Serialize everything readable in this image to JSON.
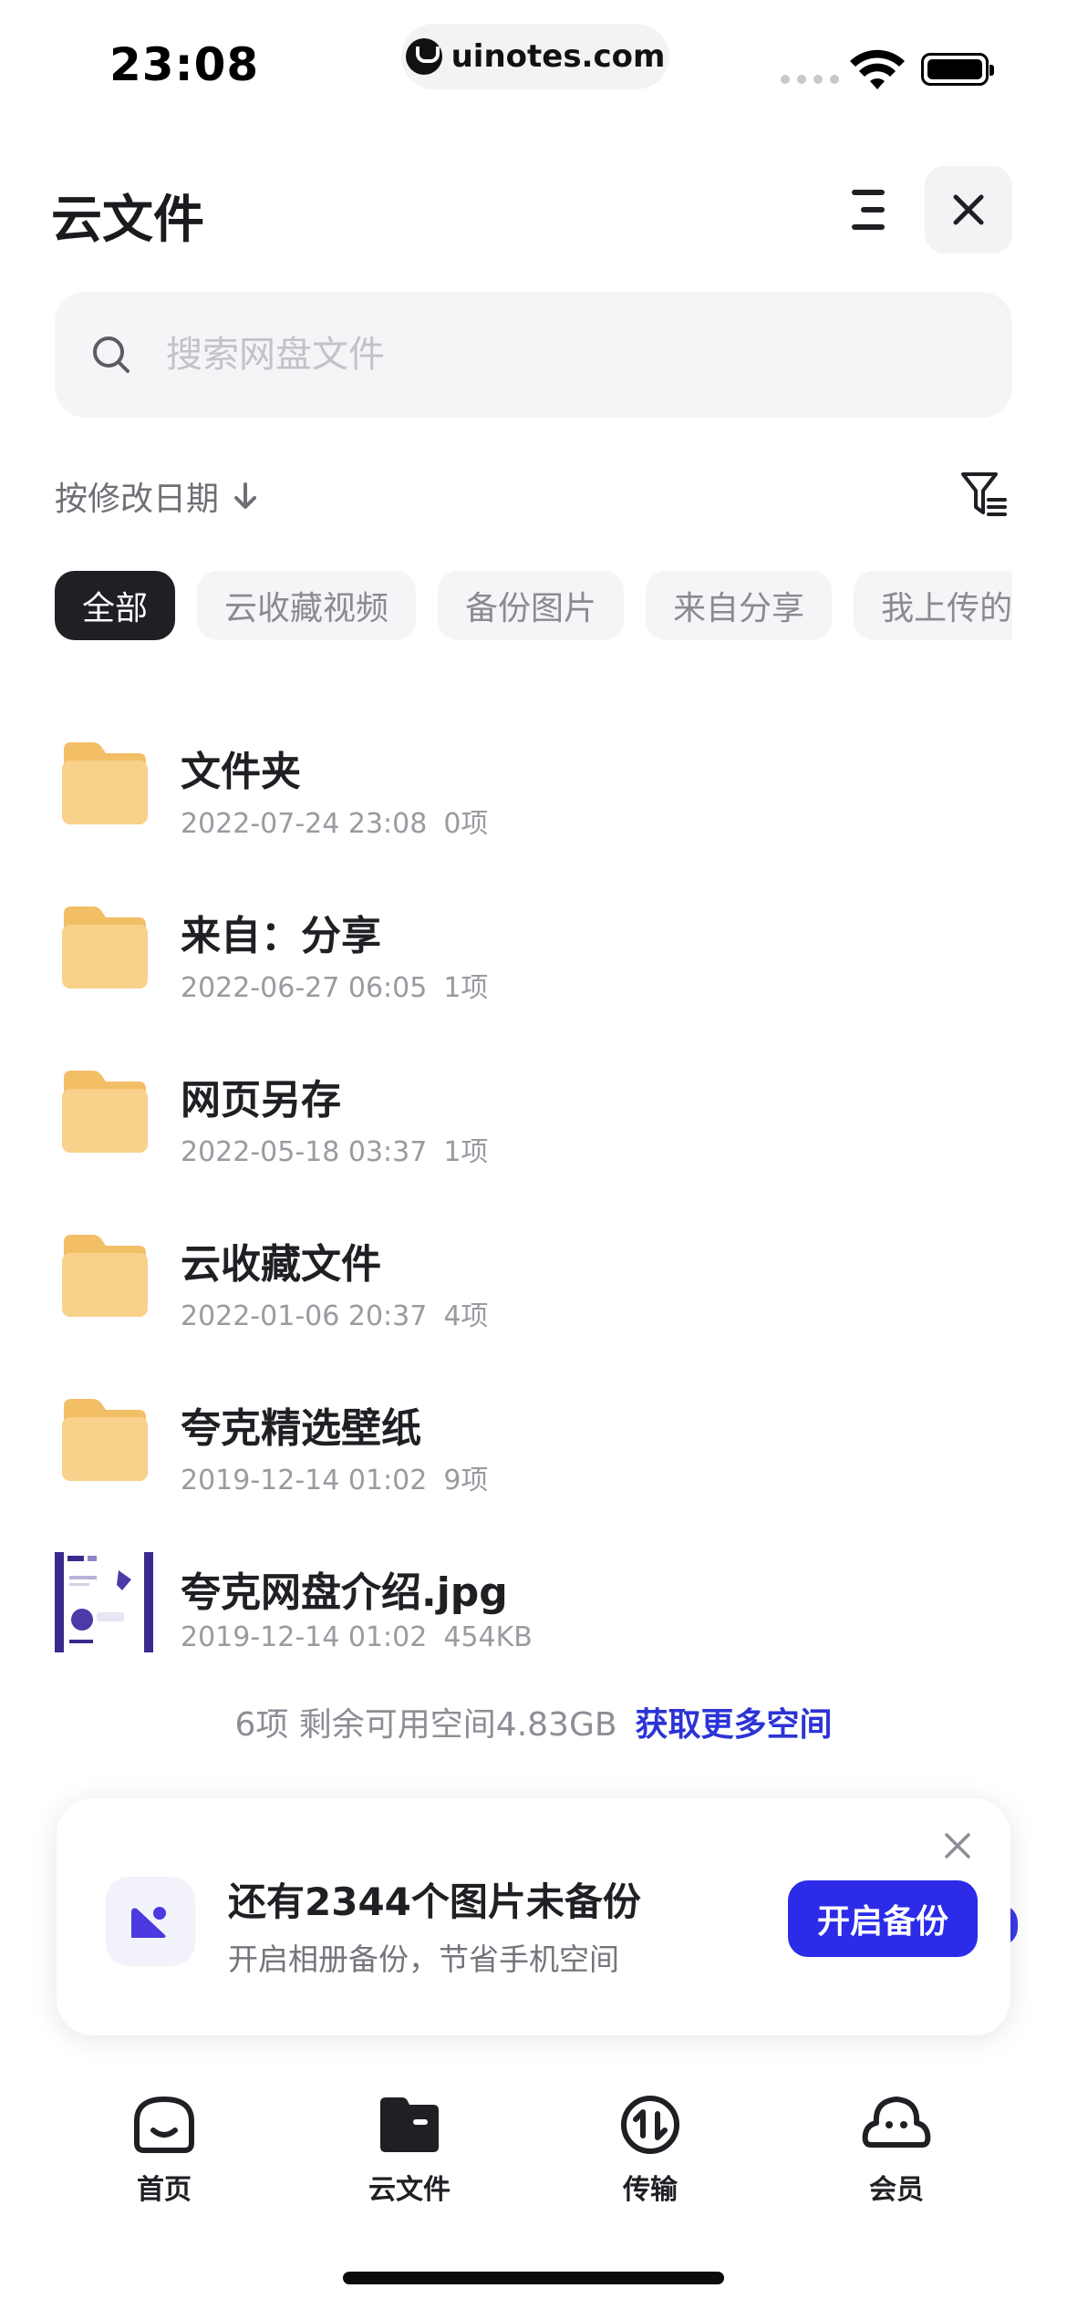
{
  "status_bar": {
    "time": "23:08",
    "url": "uinotes.com"
  },
  "header": {
    "title": "云文件"
  },
  "search": {
    "placeholder": "搜索网盘文件"
  },
  "sort": {
    "label": "按修改日期"
  },
  "chips": [
    {
      "label": "全部",
      "active": true
    },
    {
      "label": "云收藏视频",
      "active": false
    },
    {
      "label": "备份图片",
      "active": false
    },
    {
      "label": "来自分享",
      "active": false
    },
    {
      "label": "我上传的",
      "active": false
    }
  ],
  "files": [
    {
      "name": "文件夹",
      "date": "2022-07-24 23:08",
      "info": "0项",
      "type": "folder"
    },
    {
      "name": "来自：分享",
      "date": "2022-06-27 06:05",
      "info": "1项",
      "type": "folder"
    },
    {
      "name": "网页另存",
      "date": "2022-05-18 03:37",
      "info": "1项",
      "type": "folder"
    },
    {
      "name": "云收藏文件",
      "date": "2022-01-06 20:37",
      "info": "4项",
      "type": "folder"
    },
    {
      "name": "夸克精选壁纸",
      "date": "2019-12-14 01:02",
      "info": "9项",
      "type": "folder"
    },
    {
      "name": "夸克网盘介绍.jpg",
      "date": "2019-12-14 01:02",
      "info": "454KB",
      "type": "image"
    }
  ],
  "storage": {
    "summary": "6项 剩余可用空间4.83GB",
    "link": "获取更多空间"
  },
  "backup_card": {
    "title": "还有2344个图片未备份",
    "subtitle": "开启相册备份，节省手机空间",
    "button": "开启备份"
  },
  "bottom_nav": [
    {
      "label": "首页",
      "icon": "home-icon"
    },
    {
      "label": "云文件",
      "icon": "cloud-files-icon"
    },
    {
      "label": "传输",
      "icon": "transfer-icon"
    },
    {
      "label": "会员",
      "icon": "member-icon"
    }
  ],
  "colors": {
    "accent": "#2b2be8",
    "link": "#2c33d6",
    "folder": "#f6c978",
    "chip_active": "#1f1f24"
  }
}
